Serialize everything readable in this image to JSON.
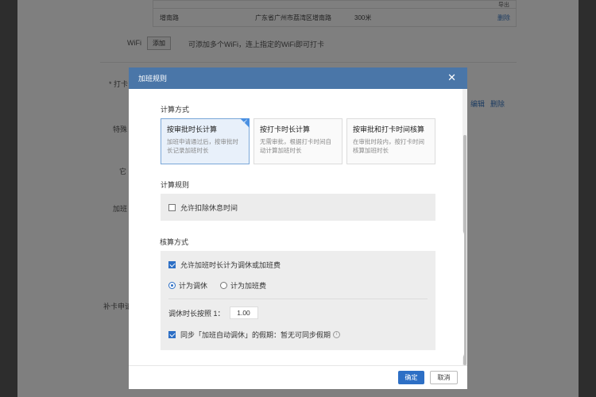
{
  "background": {
    "table_header_action": "导出",
    "table_row": {
      "name": "增南路",
      "address": "广东省广州市荔湾区增南路",
      "distance": "300米",
      "action": "删除"
    },
    "wifi_label": "WiFi",
    "wifi_add": "添加",
    "wifi_hint": "可添加多个WiFi，连上指定的WiFi即可打卡",
    "clock_label": "* 打卡",
    "edit": "编辑",
    "delete": "删除",
    "special_label": "特殊",
    "other_label": "它",
    "overtime_label": "加班",
    "makeup_label": "补卡申请"
  },
  "modal": {
    "title": "加班规则",
    "close_icon": "close-icon",
    "calc_method_title": "计算方式",
    "cards": [
      {
        "title": "按审批时长计算",
        "desc": "加班申请通过后，按审批时长记录加班时长",
        "selected": true
      },
      {
        "title": "按打卡时长计算",
        "desc": "无需审批，根据打卡时间自动计算加班时长",
        "selected": false
      },
      {
        "title": "按审批和打卡时间核算",
        "desc": "在审批时段内，按打卡时间核算加班时长",
        "selected": false
      }
    ],
    "calc_rule_title": "计算规则",
    "allow_deduct_rest": "允许扣除休息时间",
    "settle_title": "核算方式",
    "allow_convert": "允许加班时长计为调休或加班费",
    "radio_leave": "计为调休",
    "radio_pay": "计为加班费",
    "ratio_label": "调休时长按照 1：",
    "ratio_value": "1.00",
    "sync_label": "同步「加班自动调休」的假期：暂无可同步假期",
    "confirm": "确定",
    "cancel": "取消"
  }
}
